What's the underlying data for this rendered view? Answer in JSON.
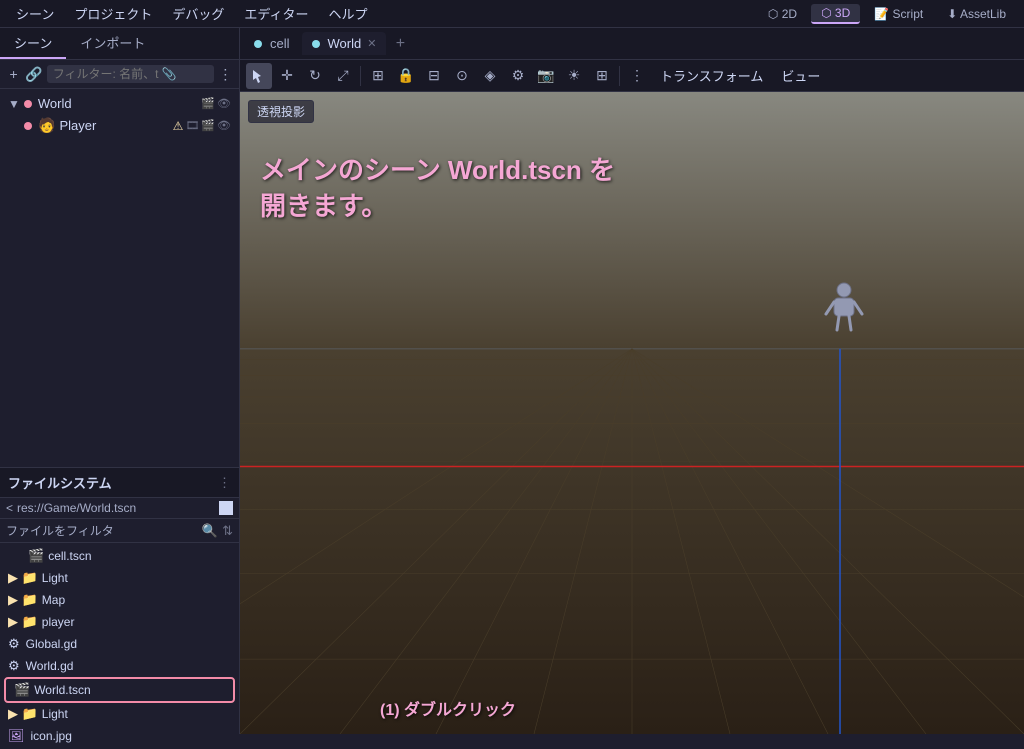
{
  "menubar": {
    "items": [
      "シーン",
      "プロジェクト",
      "デバッグ",
      "エディター",
      "ヘルプ"
    ],
    "mode_2d": "2D",
    "mode_3d": "3D",
    "script": "Script",
    "assetlib": "AssetLib"
  },
  "scene_panel": {
    "tabs": [
      "シーン",
      "インポート"
    ],
    "filter_placeholder": "フィルター: 名前、t 📎",
    "tree": [
      {
        "label": "World",
        "type": "node",
        "depth": 0,
        "is_root": true
      },
      {
        "label": "Player",
        "type": "player",
        "depth": 1,
        "has_warning": true
      }
    ]
  },
  "filesystem_panel": {
    "title": "ファイルシステム",
    "path": "res://Game/World.tscn",
    "filter_placeholder": "ファイルをフィルタ",
    "items": [
      {
        "label": "cell.tscn",
        "type": "scene",
        "depth": 1
      },
      {
        "label": "Light",
        "type": "folder",
        "depth": 0
      },
      {
        "label": "Map",
        "type": "folder",
        "depth": 0
      },
      {
        "label": "player",
        "type": "folder",
        "depth": 0
      },
      {
        "label": "Global.gd",
        "type": "gd",
        "depth": 0
      },
      {
        "label": "World.gd",
        "type": "gd",
        "depth": 0
      },
      {
        "label": "World.tscn",
        "type": "scene",
        "depth": 0,
        "highlighted": true
      },
      {
        "label": "Light",
        "type": "folder",
        "depth": 0
      },
      {
        "label": "icon.jpg",
        "type": "image",
        "depth": 0
      }
    ]
  },
  "editor_tabs": {
    "tabs": [
      {
        "label": "cell",
        "type": "scene"
      },
      {
        "label": "World",
        "type": "scene",
        "active": true,
        "closeable": true
      }
    ],
    "add_tab_label": "+"
  },
  "viewport": {
    "perspective_label": "透視投影",
    "transform_label": "トランスフォーム",
    "view_label": "ビュー",
    "annotation": "メインのシーン World.tscn を\n開きます。",
    "dblclick_label": "(1) ダブルクリック"
  }
}
